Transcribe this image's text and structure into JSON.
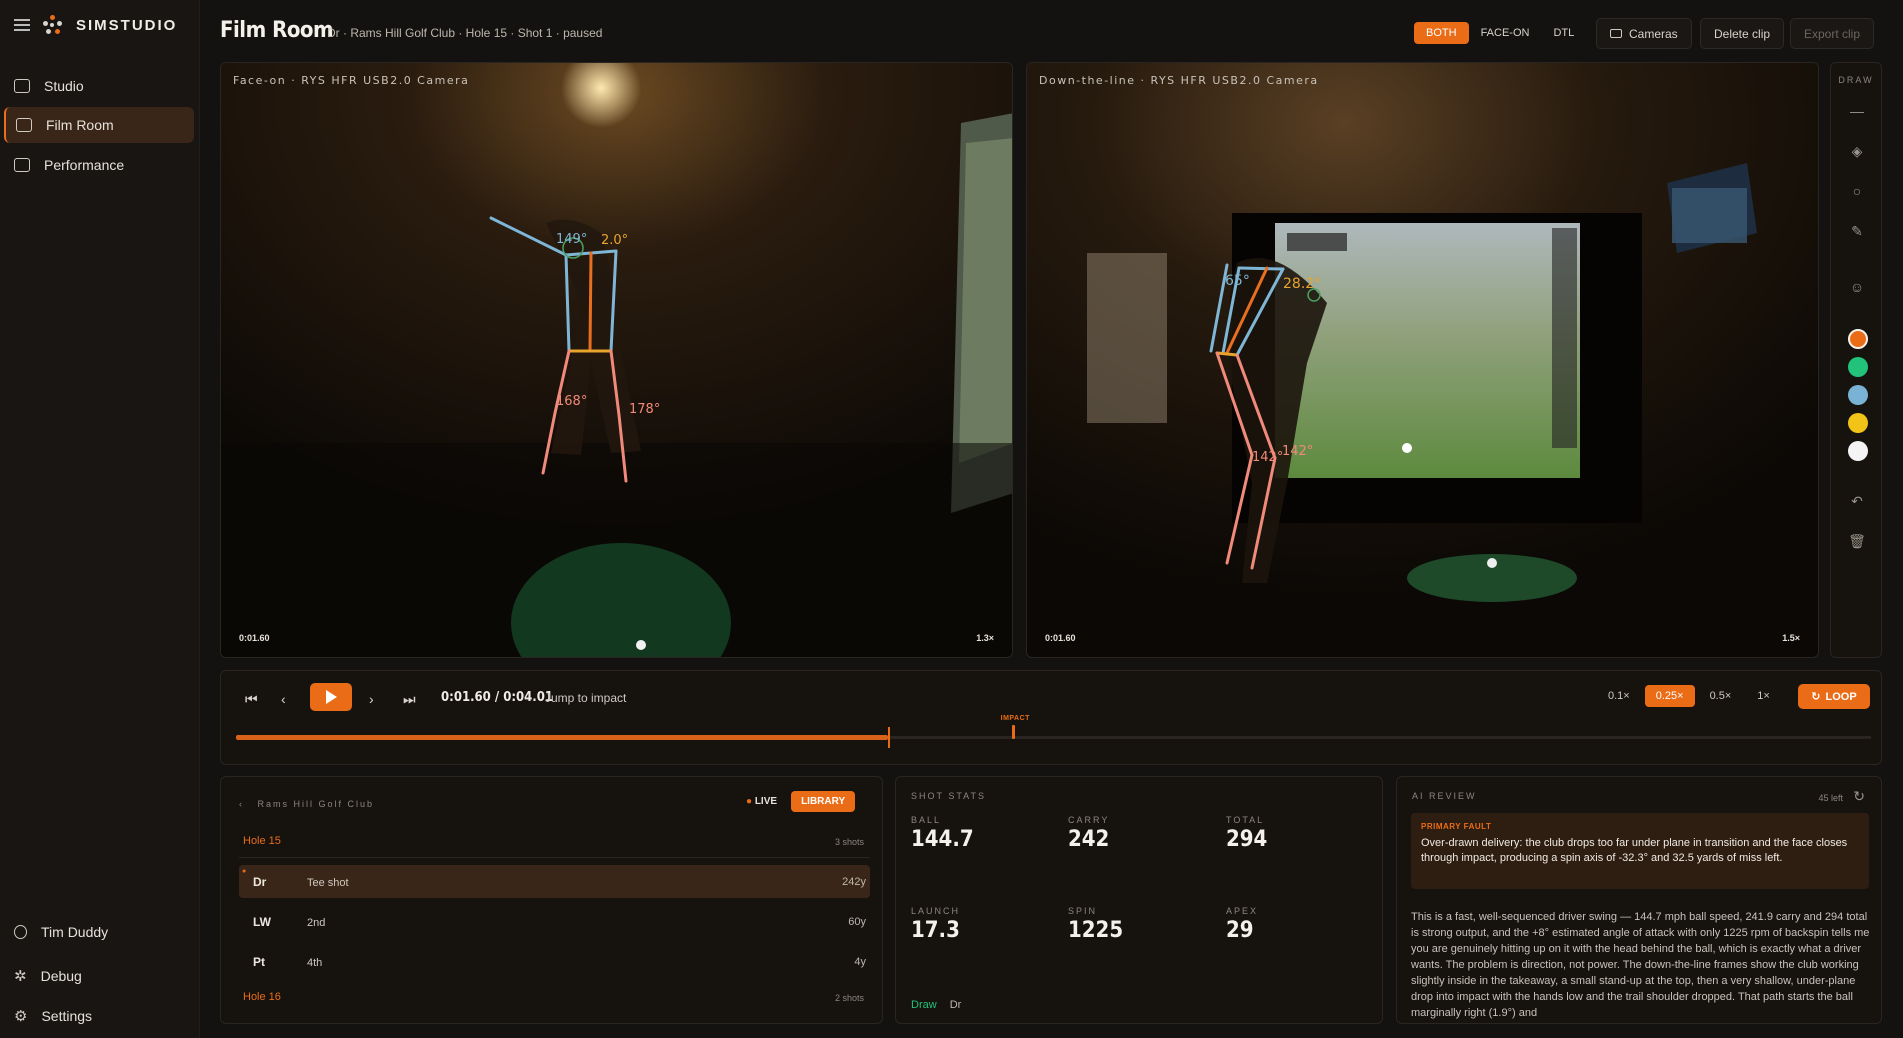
{
  "brand": {
    "name": "SIMSTUDIO"
  },
  "nav": [
    {
      "label": "Studio",
      "icon": "video-icon",
      "active": false
    },
    {
      "label": "Film Room",
      "icon": "play-square-icon",
      "active": true
    },
    {
      "label": "Performance",
      "icon": "chart-icon",
      "active": false
    }
  ],
  "sidebar_bottom": {
    "user": "Tim Duddy",
    "debug": "Debug",
    "settings": "Settings"
  },
  "header": {
    "title": "Film Room",
    "breadcrumb": "Dr · Rams Hill Golf Club · Hole 15 · Shot 1 · paused",
    "views": [
      "BOTH",
      "FACE-ON",
      "DTL"
    ],
    "active_view": "BOTH",
    "cameras": "Cameras",
    "delete": "Delete clip",
    "export": "Export clip"
  },
  "panes": {
    "face_on": {
      "label": "Face-on · RYS HFR USB2.0 Camera",
      "timecode": "0:01.60",
      "zoom": "1.3×",
      "angles": [
        "149°",
        "2.0°",
        "168°",
        "178°"
      ]
    },
    "dtl": {
      "label": "Down-the-line · RYS HFR USB2.0 Camera",
      "timecode": "0:01.60",
      "zoom": "1.5×",
      "angles": [
        "65°",
        "28.2°",
        "142°",
        "142°"
      ]
    }
  },
  "draw": {
    "label": "DRAW",
    "colors": [
      "#ea6c16",
      "#22c27a",
      "#79b2d4",
      "#f2c418",
      "#f4f4f4"
    ]
  },
  "controls": {
    "time": "0:01.60 / 0:04.01",
    "jump": "Jump to impact",
    "speeds": [
      "0.1×",
      "0.25×",
      "0.5×",
      "1×"
    ],
    "active_speed": "0.25×",
    "loop": "LOOP",
    "progress": 0.399,
    "impact_label": "IMPACT",
    "impact_pos": 0.475
  },
  "shots": {
    "course": "Rams Hill Golf Club",
    "live": "LIVE",
    "library": "LIBRARY",
    "holes": [
      {
        "name": "Hole 15",
        "count": "3 shots",
        "rows": [
          {
            "club": "Dr",
            "desc": "Tee shot",
            "yards": "242y",
            "selected": true
          },
          {
            "club": "LW",
            "desc": "2nd",
            "yards": "60y",
            "selected": false
          },
          {
            "club": "Pt",
            "desc": "4th",
            "yards": "4y",
            "selected": false
          }
        ]
      },
      {
        "name": "Hole 16",
        "count": "2 shots",
        "rows": []
      }
    ]
  },
  "stats": {
    "title": "SHOT STATS",
    "items": [
      {
        "label": "BALL",
        "value": "144.7"
      },
      {
        "label": "CARRY",
        "value": "242"
      },
      {
        "label": "TOTAL",
        "value": "294"
      },
      {
        "label": "LAUNCH",
        "value": "17.3"
      },
      {
        "label": "SPIN",
        "value": "1225"
      },
      {
        "label": "APEX",
        "value": "29"
      }
    ],
    "shape": "Draw",
    "club": "Dr"
  },
  "review": {
    "title": "AI REVIEW",
    "left": "45 left",
    "fault_label": "PRIMARY FAULT",
    "fault": "Over-drawn delivery: the club drops too far under plane in transition and the face closes through impact, producing a spin axis of -32.3° and 32.5 yards of miss left.",
    "body": "This is a fast, well-sequenced driver swing — 144.7 mph ball speed, 241.9 carry and 294 total is strong output, and the +8° estimated angle of attack with only 1225 rpm of backspin tells me you are genuinely hitting up on it with the head behind the ball, which is exactly what a driver wants. The problem is direction, not power. The down-the-line frames show the club working slightly inside in the takeaway, a small stand-up at the top, then a very shallow, under-plane drop into impact with the hands low and the trail shoulder dropped. That path starts the ball marginally right (1.9°) and"
  }
}
